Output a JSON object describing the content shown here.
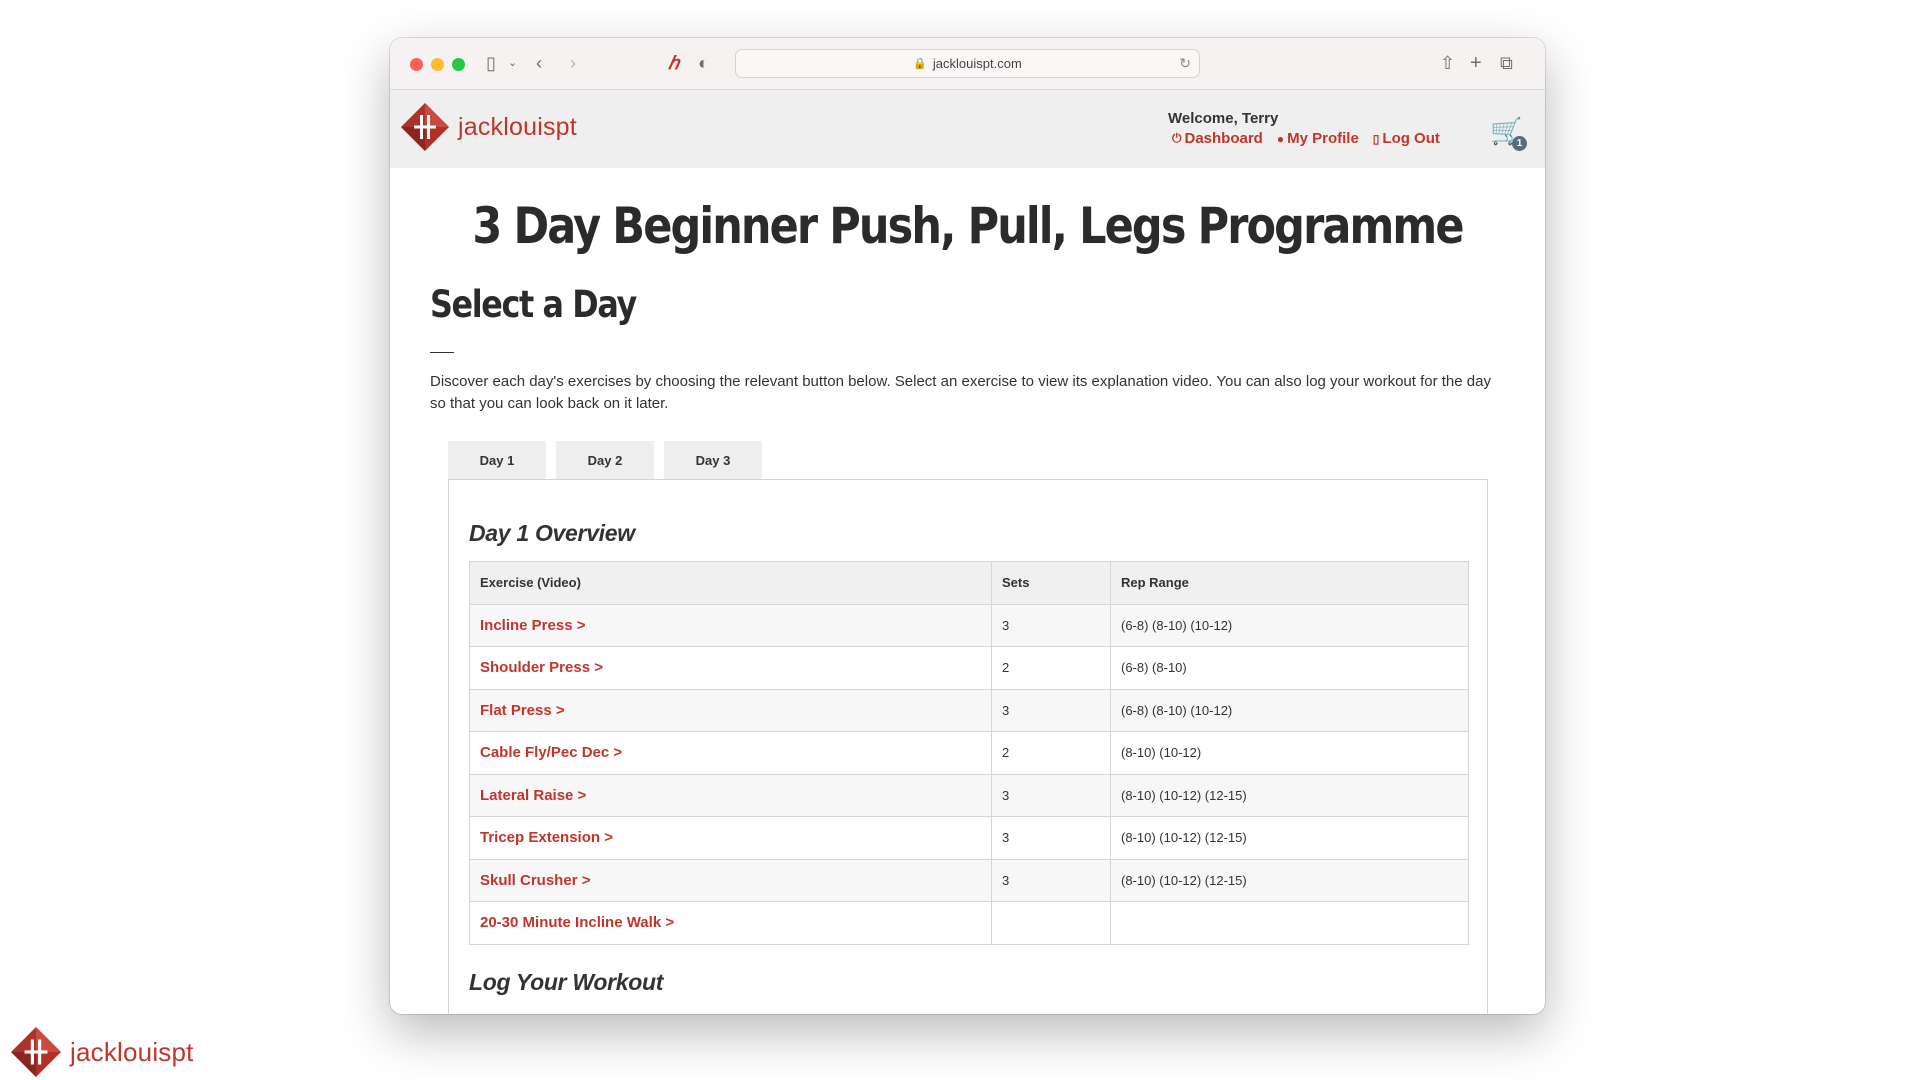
{
  "browser": {
    "url": "jacklouispt.com"
  },
  "site": {
    "logo_text": "jacklouispt",
    "welcome": "Welcome, Terry",
    "links": [
      {
        "label": "Dashboard",
        "icon": "power-icon"
      },
      {
        "label": "My Profile",
        "icon": "profile-icon"
      },
      {
        "label": "Log Out",
        "icon": "door-icon"
      }
    ],
    "cart_count": "1",
    "brand_color": "#c0362c"
  },
  "page": {
    "title": "3 Day Beginner Push, Pull, Legs Programme",
    "section_title": "Select a Day",
    "intro": "Discover each day's exercises by choosing the relevant button below. Select an exercise to view its explanation video. You can also log your workout for the day so that you can look back on it later.",
    "tabs": [
      "Day 1",
      "Day 2",
      "Day 3"
    ],
    "panel_title": "Day 1 Overview",
    "table": {
      "headers": [
        "Exercise (Video)",
        "Sets",
        "Rep Range"
      ],
      "rows": [
        {
          "exercise": "Incline Press >",
          "sets": "3",
          "reps": "(6-8) (8-10) (10-12)"
        },
        {
          "exercise": "Shoulder Press >",
          "sets": "2",
          "reps": "(6-8) (8-10)"
        },
        {
          "exercise": "Flat Press >",
          "sets": "3",
          "reps": "(6-8) (8-10) (10-12)"
        },
        {
          "exercise": "Cable Fly/Pec Dec >",
          "sets": "2",
          "reps": "(8-10) (10-12)"
        },
        {
          "exercise": "Lateral Raise >",
          "sets": "3",
          "reps": "(8-10) (10-12) (12-15)"
        },
        {
          "exercise": "Tricep Extension >",
          "sets": "3",
          "reps": "(8-10) (10-12) (12-15)"
        },
        {
          "exercise": "Skull Crusher >",
          "sets": "3",
          "reps": "(8-10) (10-12) (12-15)"
        },
        {
          "exercise": "20-30 Minute Incline Walk >",
          "sets": "",
          "reps": ""
        }
      ]
    },
    "log_title": "Log Your Workout"
  },
  "watermark": {
    "text": "jacklouispt"
  }
}
